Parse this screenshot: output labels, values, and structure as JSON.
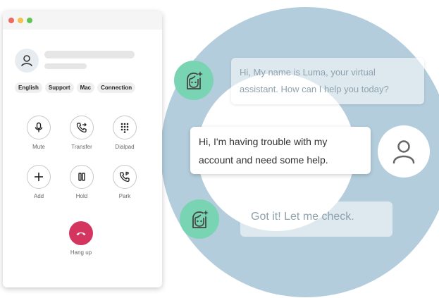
{
  "call_window": {
    "tags": [
      "English",
      "Support",
      "Mac",
      "Connection"
    ],
    "controls": [
      {
        "label": "Mute",
        "icon": "microphone-icon"
      },
      {
        "label": "Transfer",
        "icon": "call-transfer-icon"
      },
      {
        "label": "Dialpad",
        "icon": "dialpad-icon"
      },
      {
        "label": "Add",
        "icon": "plus-icon"
      },
      {
        "label": "Hold",
        "icon": "pause-icon"
      },
      {
        "label": "Park",
        "icon": "phone-park-icon"
      }
    ],
    "hangup": {
      "label": "Hang up",
      "icon": "phone-hangup-icon",
      "color": "#d3355f"
    }
  },
  "chat": {
    "bot_message_1": "Hi, My name is Luma, your virtual assistant. How can I help you today?",
    "user_message": "Hi, I'm having trouble with my account and need some help.",
    "bot_message_2": "Got it! Let me check.",
    "bot_avatar_icon": "ai-assistant-face-icon",
    "user_avatar_icon": "user-icon"
  },
  "colors": {
    "ring": "#b3cddc",
    "bot_avatar": "#79d4b3",
    "hangup": "#d3355f"
  }
}
